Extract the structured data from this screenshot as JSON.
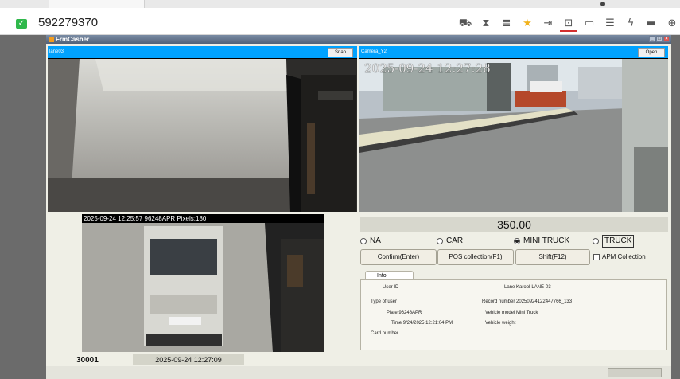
{
  "browser": {
    "record_id": "592279370",
    "toolbar_icons": [
      "cart-icon",
      "hourglass-icon",
      "database-icon",
      "star-icon",
      "export-icon",
      "popup-icon",
      "chat-icon",
      "comment-icon",
      "bolt-icon",
      "keyboard-icon",
      "extension-icon",
      "more-icon"
    ]
  },
  "window": {
    "title": "FrmCasher"
  },
  "camera_left": {
    "label": "lane03",
    "button": "Snap"
  },
  "camera_right": {
    "label": "Camera_Y2",
    "button": "Open",
    "timestamp": "2025-09-24 12:27:28"
  },
  "capture": {
    "caption": "2025-09-24 12:25:57 96248APR Pixels:180"
  },
  "amount": "350.00",
  "vehicle_types": [
    {
      "label": "NA",
      "selected": false
    },
    {
      "label": "CAR",
      "selected": false
    },
    {
      "label": "MINI TRUCK",
      "selected": true
    },
    {
      "label": "TRUCK",
      "selected": false
    }
  ],
  "actions": {
    "confirm": "Confirm(Enter)",
    "pos": "POS collection(F1)",
    "shift": "Shift(F12)",
    "apm": "APM Collection"
  },
  "info": {
    "tab": "Info",
    "user_id_label": "User ID",
    "lane_text": "Lane Karool-LANE-03",
    "type_of_user_label": "Type of user",
    "record_number": "Record number 20250924122447766_133",
    "plate": "Plate 96248APR",
    "vehicle_model": "Vehicle model Mini Truck",
    "time": "Time 9/24/2025 12:21:04 PM",
    "vehicle_weight": "Vehicle weight",
    "card_number": "Card number"
  },
  "status": {
    "code": "30001",
    "datetime": "2025-09-24 12:27:09"
  }
}
